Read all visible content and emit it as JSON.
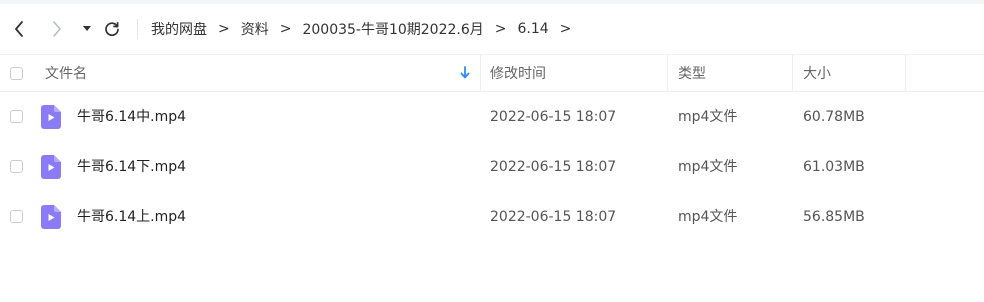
{
  "breadcrumb": [
    "我的网盘",
    "资料",
    "200035-牛哥10期2022.6月",
    "6.14"
  ],
  "breadcrumb_separator": ">",
  "columns": {
    "name": "文件名",
    "modified": "修改时间",
    "type": "类型",
    "size": "大小"
  },
  "files": [
    {
      "name": "牛哥6.14中.mp4",
      "modified": "2022-06-15 18:07",
      "type": "mp4文件",
      "size": "60.78MB"
    },
    {
      "name": "牛哥6.14下.mp4",
      "modified": "2022-06-15 18:07",
      "type": "mp4文件",
      "size": "61.03MB"
    },
    {
      "name": "牛哥6.14上.mp4",
      "modified": "2022-06-15 18:07",
      "type": "mp4文件",
      "size": "56.85MB"
    }
  ],
  "icons": {
    "back": "chevron-left-icon",
    "forward": "chevron-right-icon",
    "history": "caret-down-icon",
    "refresh": "refresh-icon",
    "sort": "arrow-down-icon",
    "file": "video-file-icon"
  },
  "colors": {
    "file_icon": "#8b7cf6",
    "sort_arrow": "#2f8cf4",
    "divider": "#eef0f3"
  }
}
